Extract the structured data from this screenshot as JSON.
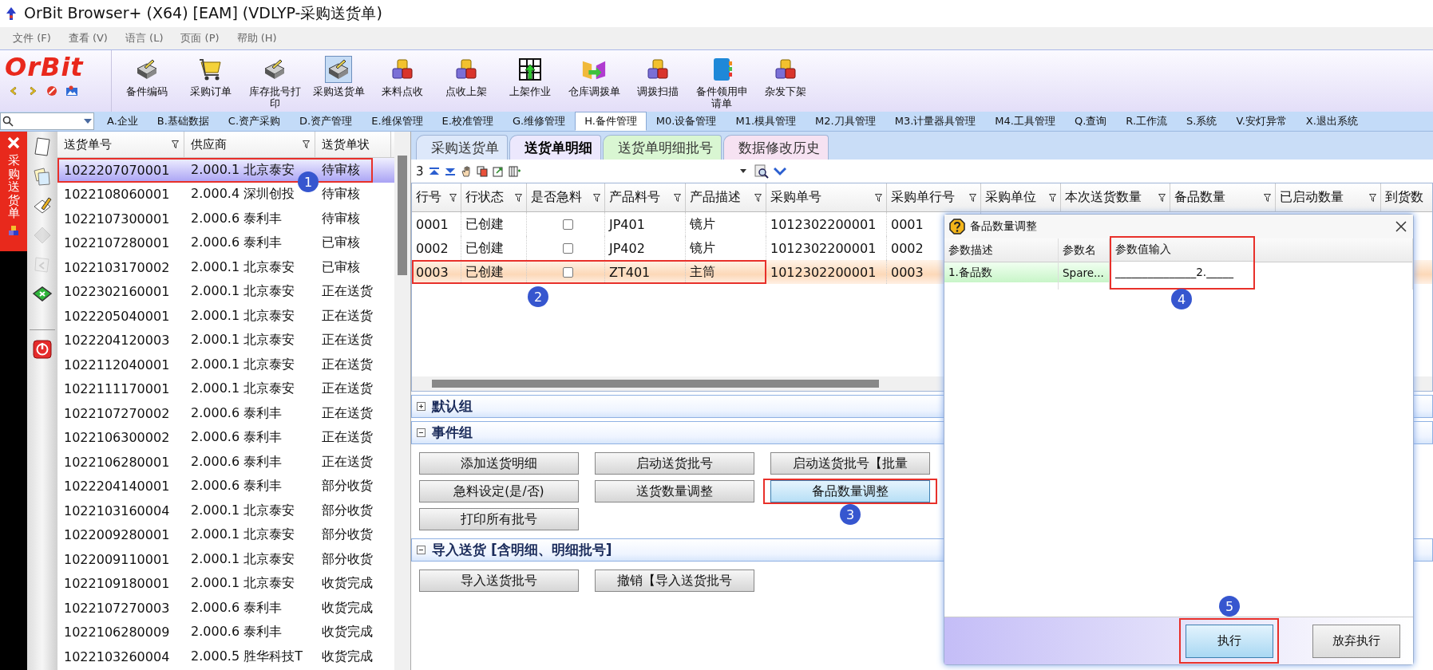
{
  "window": {
    "title": "OrBit Browser+ (X64) [EAM] (VDLYP-采购送货单)"
  },
  "menu": [
    "文件 (F)",
    "查看 (V)",
    "语言 (L)",
    "页面 (P)",
    "帮助 (H)"
  ],
  "logo": "OrBit",
  "quick_icons": [
    {
      "kind": "back"
    },
    {
      "kind": "forward"
    },
    {
      "kind": "stop"
    },
    {
      "kind": "image"
    }
  ],
  "toolbar": [
    {
      "label": "备件编码",
      "kind": "tray",
      "selected": false
    },
    {
      "label": "采购订单",
      "kind": "cart",
      "selected": false
    },
    {
      "label": "库存批号打印",
      "kind": "tray",
      "selected": false
    },
    {
      "label": "采购送货单",
      "kind": "tray",
      "selected": true
    },
    {
      "label": "来料点收",
      "kind": "cubes",
      "selected": false
    },
    {
      "label": "点收上架",
      "kind": "cubes",
      "selected": false
    },
    {
      "label": "上架作业",
      "kind": "grid",
      "selected": false
    },
    {
      "label": "仓库调拨单",
      "kind": "folder",
      "selected": false
    },
    {
      "label": "调拨扫描",
      "kind": "cubes",
      "selected": false
    },
    {
      "label": "备件领用申请单",
      "kind": "binder",
      "selected": false
    },
    {
      "label": "杂发下架",
      "kind": "cubes",
      "selected": false
    }
  ],
  "modules": [
    {
      "label": "A.企业",
      "selected": false
    },
    {
      "label": "B.基础数据",
      "selected": false
    },
    {
      "label": "C.资产采购",
      "selected": false
    },
    {
      "label": "D.资产管理",
      "selected": false
    },
    {
      "label": "E.维保管理",
      "selected": false
    },
    {
      "label": "E.校准管理",
      "selected": false
    },
    {
      "label": "G.维修管理",
      "selected": false
    },
    {
      "label": "H.备件管理",
      "selected": true
    },
    {
      "label": "M0.设备管理",
      "selected": false
    },
    {
      "label": "M1.模具管理",
      "selected": false
    },
    {
      "label": "M2.刀具管理",
      "selected": false
    },
    {
      "label": "M3.计量器具管理",
      "selected": false
    },
    {
      "label": "M4.工具管理",
      "selected": false
    },
    {
      "label": "Q.查询",
      "selected": false
    },
    {
      "label": "R.工作流",
      "selected": false
    },
    {
      "label": "S.系统",
      "selected": false
    },
    {
      "label": "V.安灯异常",
      "selected": false
    },
    {
      "label": "X.退出系统",
      "selected": false
    }
  ],
  "side_tab": {
    "label": "采购送货单"
  },
  "side_tools": [
    {
      "kind": "page",
      "disabled": false
    },
    {
      "kind": "documents",
      "disabled": false
    },
    {
      "kind": "pencil",
      "disabled": false
    },
    {
      "kind": "diamond",
      "disabled": true
    },
    {
      "kind": "reply",
      "disabled": true
    },
    {
      "kind": "app",
      "disabled": false
    },
    {
      "kind": "power",
      "disabled": false
    }
  ],
  "doc_list": {
    "columns": [
      "送货单号",
      "供应商",
      "送货单状"
    ],
    "rows": [
      {
        "cells": [
          "1022207070001",
          "2.000.1 北京泰安",
          "待审核"
        ],
        "selected": true,
        "highlighted": true
      },
      {
        "cells": [
          "1022108060001",
          "2.000.4 深圳创投",
          "待审核"
        ],
        "selected": false,
        "highlighted": false
      },
      {
        "cells": [
          "1022107300001",
          "2.000.6 泰利丰",
          "待审核"
        ],
        "selected": false,
        "highlighted": false
      },
      {
        "cells": [
          "1022107280001",
          "2.000.6 泰利丰",
          "已审核"
        ],
        "selected": false,
        "highlighted": false
      },
      {
        "cells": [
          "1022103170002",
          "2.000.1 北京泰安",
          "已审核"
        ],
        "selected": false,
        "highlighted": false
      },
      {
        "cells": [
          "1022302160001",
          "2.000.1 北京泰安",
          "正在送货"
        ],
        "selected": false,
        "highlighted": false
      },
      {
        "cells": [
          "1022205040001",
          "2.000.1 北京泰安",
          "正在送货"
        ],
        "selected": false,
        "highlighted": false
      },
      {
        "cells": [
          "1022204120003",
          "2.000.1 北京泰安",
          "正在送货"
        ],
        "selected": false,
        "highlighted": false
      },
      {
        "cells": [
          "1022112040001",
          "2.000.1 北京泰安",
          "正在送货"
        ],
        "selected": false,
        "highlighted": false
      },
      {
        "cells": [
          "1022111170001",
          "2.000.1 北京泰安",
          "正在送货"
        ],
        "selected": false,
        "highlighted": false
      },
      {
        "cells": [
          "1022107270002",
          "2.000.6 泰利丰",
          "正在送货"
        ],
        "selected": false,
        "highlighted": false
      },
      {
        "cells": [
          "1022106300002",
          "2.000.6 泰利丰",
          "正在送货"
        ],
        "selected": false,
        "highlighted": false
      },
      {
        "cells": [
          "1022106280001",
          "2.000.6 泰利丰",
          "正在送货"
        ],
        "selected": false,
        "highlighted": false
      },
      {
        "cells": [
          "1022204140001",
          "2.000.6 泰利丰",
          "部分收货"
        ],
        "selected": false,
        "highlighted": false
      },
      {
        "cells": [
          "1022103160004",
          "2.000.1 北京泰安",
          "部分收货"
        ],
        "selected": false,
        "highlighted": false
      },
      {
        "cells": [
          "1022009280001",
          "2.000.1 北京泰安",
          "部分收货"
        ],
        "selected": false,
        "highlighted": false
      },
      {
        "cells": [
          "1022009110001",
          "2.000.1 北京泰安",
          "部分收货"
        ],
        "selected": false,
        "highlighted": false
      },
      {
        "cells": [
          "1022109180001",
          "2.000.1 北京泰安",
          "收货完成"
        ],
        "selected": false,
        "highlighted": false
      },
      {
        "cells": [
          "1022107270003",
          "2.000.6 泰利丰",
          "收货完成"
        ],
        "selected": false,
        "highlighted": false
      },
      {
        "cells": [
          "1022106280009",
          "2.000.6 泰利丰",
          "收货完成"
        ],
        "selected": false,
        "highlighted": false
      },
      {
        "cells": [
          "1022103260004",
          "2.000.5 胜华科技T",
          "收货完成"
        ],
        "selected": false,
        "highlighted": false
      }
    ]
  },
  "detail_tabs": [
    {
      "label": "采购送货单",
      "selected": false,
      "color": "#dde8fa"
    },
    {
      "label": "送货单明细",
      "selected": true,
      "color": "#ece8fd"
    },
    {
      "label": "送货单明细批号",
      "selected": false,
      "color": "#d9f6d2"
    },
    {
      "label": "数据修改历史",
      "selected": false,
      "color": "#f6e2f2"
    }
  ],
  "grid_toolbar": {
    "count": "3"
  },
  "grid": {
    "columns": [
      "行号",
      "行状态",
      "是否急料",
      "产品料号",
      "产品描述",
      "采购单号",
      "采购单行号",
      "采购单位",
      "本次送货数量",
      "备品数量",
      "已启动数量",
      "到货数"
    ],
    "rows": [
      {
        "line": "0001",
        "status": "已创建",
        "urgent": false,
        "part": "JP401",
        "desc": "镜片",
        "po": "1012302200001",
        "po_line": "0001",
        "selected": false,
        "highlighted": false
      },
      {
        "line": "0002",
        "status": "已创建",
        "urgent": false,
        "part": "JP402",
        "desc": "镜片",
        "po": "1012302200001",
        "po_line": "0002",
        "selected": false,
        "highlighted": false
      },
      {
        "line": "0003",
        "status": "已创建",
        "urgent": false,
        "part": "ZT401",
        "desc": "主筒",
        "po": "1012302200001",
        "po_line": "0003",
        "selected": true,
        "highlighted": true
      }
    ]
  },
  "groups": [
    {
      "title": "默认组",
      "expanded": false
    },
    {
      "title": "事件组",
      "expanded": true,
      "buttons": [
        {
          "label": "添加送货明细",
          "focused": false,
          "highlighted": false
        },
        {
          "label": "启动送货批号",
          "focused": false,
          "highlighted": false
        },
        {
          "label": "启动送货批号【批量",
          "focused": false,
          "highlighted": false
        },
        {
          "label": "急料设定(是/否)",
          "focused": false,
          "highlighted": false
        },
        {
          "label": "送货数量调整",
          "focused": false,
          "highlighted": false
        },
        {
          "label": "备品数量调整",
          "focused": true,
          "highlighted": true
        },
        {
          "label": "打印所有批号",
          "focused": false,
          "highlighted": false
        }
      ]
    },
    {
      "title": "导入送货 [含明细、明细批号]",
      "expanded": true,
      "buttons": [
        {
          "label": "导入送货批号",
          "focused": false,
          "highlighted": false
        },
        {
          "label": "撤销【导入送货批号",
          "focused": false,
          "highlighted": false
        }
      ]
    }
  ],
  "dialog": {
    "title": "备品数量调整",
    "columns": [
      "参数描述",
      "参数名",
      "参数值输入"
    ],
    "rows": [
      {
        "description": "1.备品数",
        "name": "Spare...",
        "value": "_______________2._____"
      }
    ],
    "value_highlighted": true,
    "buttons": [
      {
        "label": "执行",
        "focused": true,
        "highlighted": true
      },
      {
        "label": "放弃执行",
        "focused": false,
        "highlighted": false
      }
    ]
  },
  "annotations": [
    {
      "number": "1"
    },
    {
      "number": "2"
    },
    {
      "number": "3"
    },
    {
      "number": "4"
    },
    {
      "number": "5"
    }
  ]
}
